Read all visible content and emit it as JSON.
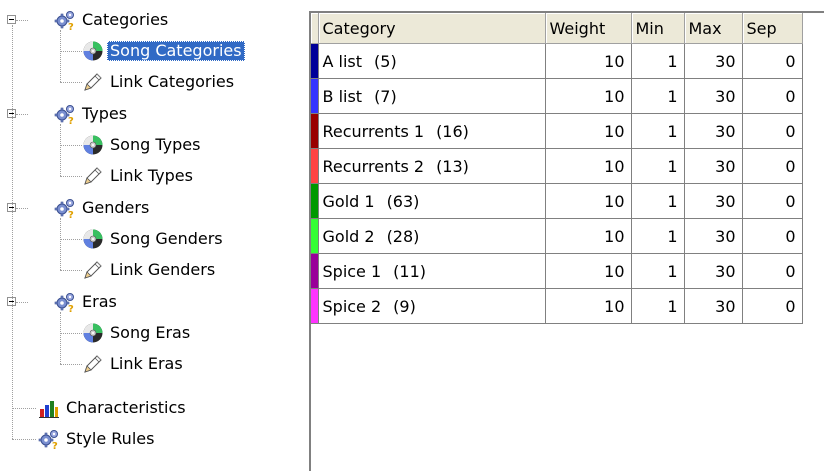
{
  "tree": {
    "groups": [
      {
        "label": "Categories",
        "icon": "gears-icon",
        "children": [
          {
            "label": "Song Categories",
            "icon": "cd-icon",
            "selected": true
          },
          {
            "label": "Link Categories",
            "icon": "pencil-icon",
            "selected": false
          }
        ]
      },
      {
        "label": "Types",
        "icon": "gears-icon",
        "children": [
          {
            "label": "Song Types",
            "icon": "cd-icon",
            "selected": false
          },
          {
            "label": "Link Types",
            "icon": "pencil-icon",
            "selected": false
          }
        ]
      },
      {
        "label": "Genders",
        "icon": "gears-icon",
        "children": [
          {
            "label": "Song Genders",
            "icon": "cd-icon",
            "selected": false
          },
          {
            "label": "Link Genders",
            "icon": "pencil-icon",
            "selected": false
          }
        ]
      },
      {
        "label": "Eras",
        "icon": "gears-icon",
        "children": [
          {
            "label": "Song Eras",
            "icon": "cd-icon",
            "selected": false
          },
          {
            "label": "Link Eras",
            "icon": "pencil-icon",
            "selected": false
          }
        ]
      }
    ],
    "leaves": [
      {
        "label": "Characteristics",
        "icon": "bar-chart-icon"
      },
      {
        "label": "Style Rules",
        "icon": "gears-icon"
      }
    ]
  },
  "grid": {
    "headers": {
      "category": "Category",
      "weight": "Weight",
      "min": "Min",
      "max": "Max",
      "sep": "Sep"
    },
    "rows": [
      {
        "name": "A list",
        "count": "(5)",
        "color": "#000099",
        "weight": "10",
        "min": "1",
        "max": "30",
        "sep": "0"
      },
      {
        "name": "B list",
        "count": "(7)",
        "color": "#3333ff",
        "weight": "10",
        "min": "1",
        "max": "30",
        "sep": "0"
      },
      {
        "name": "Recurrents 1",
        "count": "(16)",
        "color": "#990000",
        "weight": "10",
        "min": "1",
        "max": "30",
        "sep": "0"
      },
      {
        "name": "Recurrents 2",
        "count": "(13)",
        "color": "#ff4444",
        "weight": "10",
        "min": "1",
        "max": "30",
        "sep": "0"
      },
      {
        "name": "Gold 1",
        "count": "(63)",
        "color": "#009900",
        "weight": "10",
        "min": "1",
        "max": "30",
        "sep": "0"
      },
      {
        "name": "Gold 2",
        "count": "(28)",
        "color": "#33ff33",
        "weight": "10",
        "min": "1",
        "max": "30",
        "sep": "0"
      },
      {
        "name": "Spice 1",
        "count": "(11)",
        "color": "#990099",
        "weight": "10",
        "min": "1",
        "max": "30",
        "sep": "0"
      },
      {
        "name": "Spice 2",
        "count": "(9)",
        "color": "#ff33ff",
        "weight": "10",
        "min": "1",
        "max": "30",
        "sep": "0"
      }
    ]
  }
}
